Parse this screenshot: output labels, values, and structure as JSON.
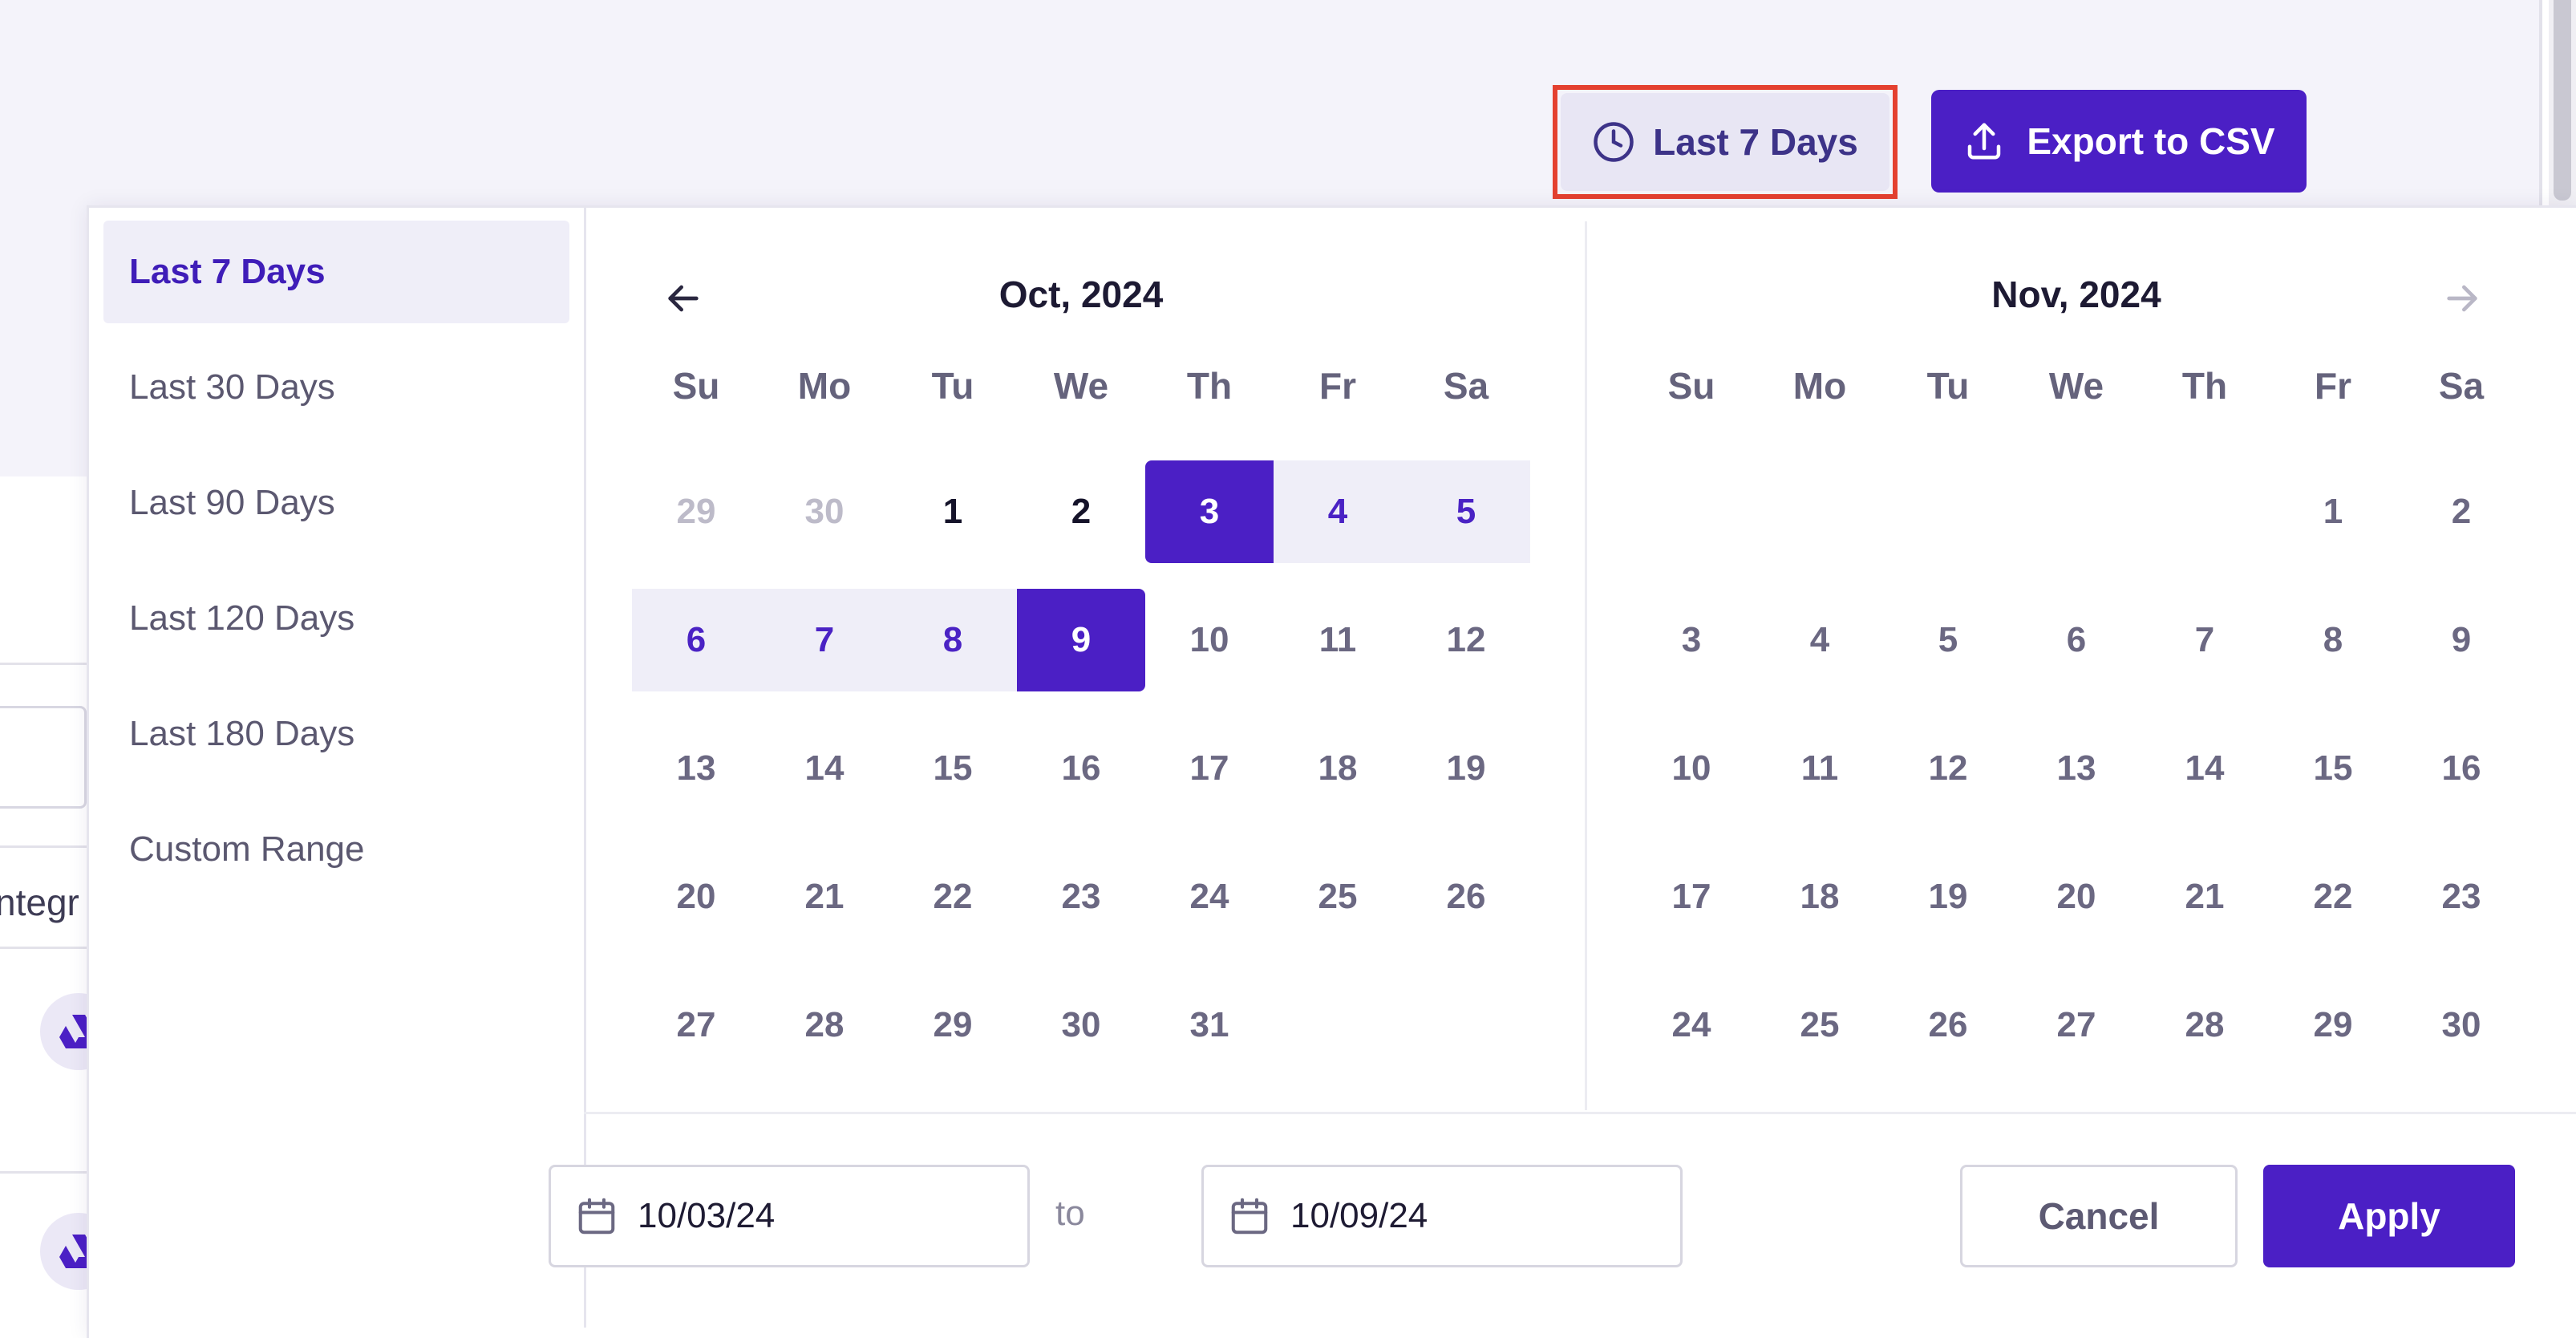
{
  "header": {
    "range_button_label": "Last 7 Days",
    "export_button_label": "Export to CSV"
  },
  "background": {
    "partial_text": "ntegr"
  },
  "presets": [
    {
      "label": "Last 7 Days",
      "active": true
    },
    {
      "label": "Last 30 Days",
      "active": false
    },
    {
      "label": "Last 90 Days",
      "active": false
    },
    {
      "label": "Last 120 Days",
      "active": false
    },
    {
      "label": "Last 180 Days",
      "active": false
    },
    {
      "label": "Custom Range",
      "active": false
    }
  ],
  "calendar": {
    "weekdays": [
      "Su",
      "Mo",
      "Tu",
      "We",
      "Th",
      "Fr",
      "Sa"
    ],
    "months": [
      {
        "title": "Oct, 2024",
        "weeks": [
          [
            {
              "d": "29",
              "s": "muted"
            },
            {
              "d": "30",
              "s": "muted"
            },
            {
              "d": "1",
              "s": "dark"
            },
            {
              "d": "2",
              "s": "dark"
            },
            {
              "d": "3",
              "s": "start"
            },
            {
              "d": "4",
              "s": "range"
            },
            {
              "d": "5",
              "s": "range"
            }
          ],
          [
            {
              "d": "6",
              "s": "range"
            },
            {
              "d": "7",
              "s": "range"
            },
            {
              "d": "8",
              "s": "range"
            },
            {
              "d": "9",
              "s": "end"
            },
            {
              "d": "10",
              "s": "normal"
            },
            {
              "d": "11",
              "s": "normal"
            },
            {
              "d": "12",
              "s": "normal"
            }
          ],
          [
            {
              "d": "13",
              "s": "normal"
            },
            {
              "d": "14",
              "s": "normal"
            },
            {
              "d": "15",
              "s": "normal"
            },
            {
              "d": "16",
              "s": "normal"
            },
            {
              "d": "17",
              "s": "normal"
            },
            {
              "d": "18",
              "s": "normal"
            },
            {
              "d": "19",
              "s": "normal"
            }
          ],
          [
            {
              "d": "20",
              "s": "normal"
            },
            {
              "d": "21",
              "s": "normal"
            },
            {
              "d": "22",
              "s": "normal"
            },
            {
              "d": "23",
              "s": "normal"
            },
            {
              "d": "24",
              "s": "normal"
            },
            {
              "d": "25",
              "s": "normal"
            },
            {
              "d": "26",
              "s": "normal"
            }
          ],
          [
            {
              "d": "27",
              "s": "normal"
            },
            {
              "d": "28",
              "s": "normal"
            },
            {
              "d": "29",
              "s": "normal"
            },
            {
              "d": "30",
              "s": "normal"
            },
            {
              "d": "31",
              "s": "normal"
            },
            {
              "d": "",
              "s": "empty"
            },
            {
              "d": "",
              "s": "empty"
            }
          ]
        ]
      },
      {
        "title": "Nov, 2024",
        "weeks": [
          [
            {
              "d": "",
              "s": "empty"
            },
            {
              "d": "",
              "s": "empty"
            },
            {
              "d": "",
              "s": "empty"
            },
            {
              "d": "",
              "s": "empty"
            },
            {
              "d": "",
              "s": "empty"
            },
            {
              "d": "1",
              "s": "normal"
            },
            {
              "d": "2",
              "s": "normal"
            }
          ],
          [
            {
              "d": "3",
              "s": "normal"
            },
            {
              "d": "4",
              "s": "normal"
            },
            {
              "d": "5",
              "s": "normal"
            },
            {
              "d": "6",
              "s": "normal"
            },
            {
              "d": "7",
              "s": "normal"
            },
            {
              "d": "8",
              "s": "normal"
            },
            {
              "d": "9",
              "s": "normal"
            }
          ],
          [
            {
              "d": "10",
              "s": "normal"
            },
            {
              "d": "11",
              "s": "normal"
            },
            {
              "d": "12",
              "s": "normal"
            },
            {
              "d": "13",
              "s": "normal"
            },
            {
              "d": "14",
              "s": "normal"
            },
            {
              "d": "15",
              "s": "normal"
            },
            {
              "d": "16",
              "s": "normal"
            }
          ],
          [
            {
              "d": "17",
              "s": "normal"
            },
            {
              "d": "18",
              "s": "normal"
            },
            {
              "d": "19",
              "s": "normal"
            },
            {
              "d": "20",
              "s": "normal"
            },
            {
              "d": "21",
              "s": "normal"
            },
            {
              "d": "22",
              "s": "normal"
            },
            {
              "d": "23",
              "s": "normal"
            }
          ],
          [
            {
              "d": "24",
              "s": "normal"
            },
            {
              "d": "25",
              "s": "normal"
            },
            {
              "d": "26",
              "s": "normal"
            },
            {
              "d": "27",
              "s": "normal"
            },
            {
              "d": "28",
              "s": "normal"
            },
            {
              "d": "29",
              "s": "normal"
            },
            {
              "d": "30",
              "s": "normal"
            }
          ]
        ]
      }
    ]
  },
  "footer": {
    "start_date": "10/03/24",
    "end_date": "10/09/24",
    "to_label": "to",
    "cancel_label": "Cancel",
    "apply_label": "Apply"
  },
  "icons": {
    "range_button": "clock-icon",
    "export_button": "upload-icon",
    "prev_month": "arrow-left-icon",
    "next_month": "arrow-right-icon",
    "date_field": "calendar-icon",
    "background_avatar": "drive-logo-icon"
  },
  "colors": {
    "primary": "#4b1fc5",
    "range_fill": "#efeef8",
    "highlight_border": "#e4402f",
    "range_text": "#4a22c4"
  }
}
